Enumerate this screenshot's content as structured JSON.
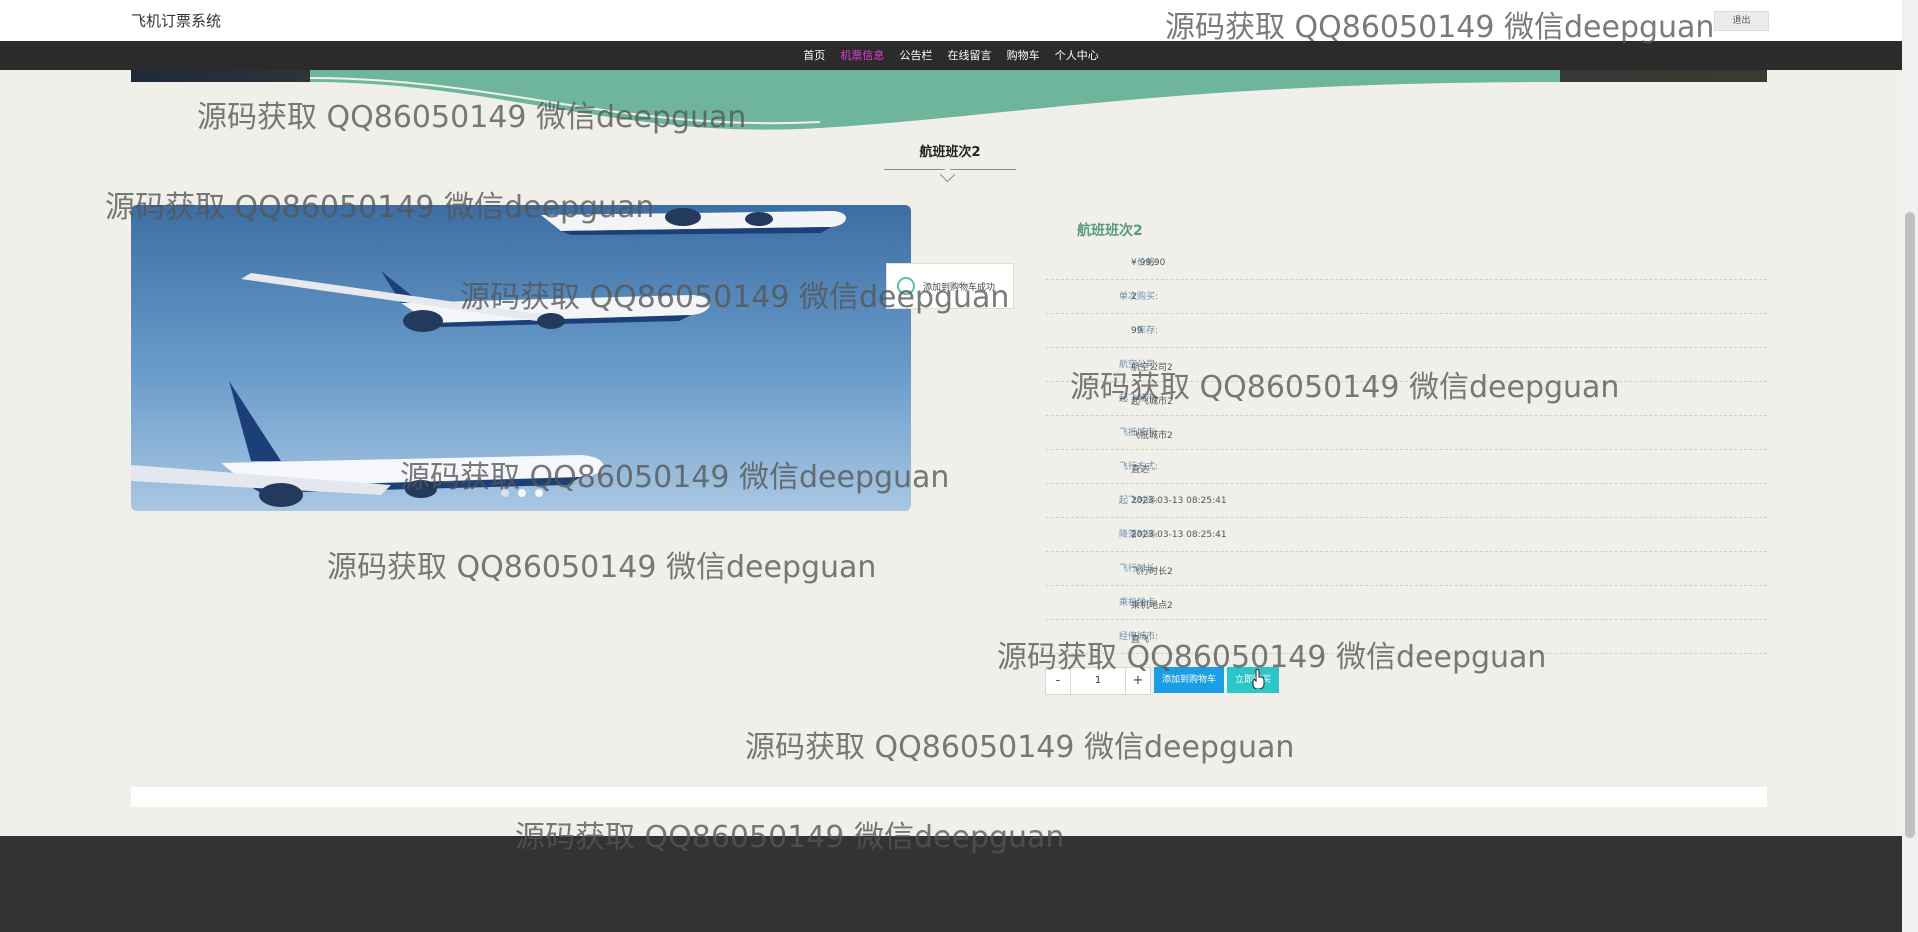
{
  "header": {
    "site_title": "飞机订票系统",
    "logout_label": "退出"
  },
  "nav": {
    "items": [
      {
        "label": "首页",
        "active": false
      },
      {
        "label": "机票信息",
        "active": true
      },
      {
        "label": "公告栏",
        "active": false
      },
      {
        "label": "在线留言",
        "active": false
      },
      {
        "label": "购物车",
        "active": false
      },
      {
        "label": "个人中心",
        "active": false
      }
    ]
  },
  "section": {
    "title": "航班班次2"
  },
  "toast": {
    "icon": "smile-icon",
    "message": "添加到购物车成功"
  },
  "product": {
    "name": "航班班次2",
    "fields": [
      {
        "label": "价格:",
        "value": "¥ 99.90"
      },
      {
        "label": "单次购买:",
        "value": "2"
      },
      {
        "label": "库存:",
        "value": "99"
      },
      {
        "label": "航空公司:",
        "value": "航空公司2"
      },
      {
        "label": "起飞城市:",
        "value": "起飞城市2"
      },
      {
        "label": "飞抵城市:",
        "value": "飞抵城市2"
      },
      {
        "label": "飞行方式:",
        "value": "直达"
      },
      {
        "label": "起飞时间:",
        "value": "2023-03-13 08:25:41"
      },
      {
        "label": "降落时间:",
        "value": "2023-03-13 08:25:41"
      },
      {
        "label": "飞行时长:",
        "value": "飞行时长2"
      },
      {
        "label": "乘机地点:",
        "value": "乘机地点2"
      },
      {
        "label": "经停城市:",
        "value": "直飞"
      }
    ]
  },
  "purchase": {
    "minus": "-",
    "quantity": "1",
    "plus": "+",
    "add_to_cart": "添加到购物车",
    "buy_now": "立即购买"
  },
  "watermarks": [
    "源码获取 QQ86050149 微信deepguan",
    "源码获取 QQ86050149 微信deepguan",
    "源码获取 QQ86050149 微信deepguan",
    "源码获取 QQ86050149 微信deepguan",
    "源码获取 QQ86050149 微信deepguan",
    "源码获取 QQ86050149 微信deepguan",
    "源码获取 QQ86050149 微信deepguan",
    "源码获取 QQ86050149 微信deepguan",
    "源码获取 QQ86050149 微信deepguan",
    "源码获取 QQ86050149 微信deepguan"
  ]
}
